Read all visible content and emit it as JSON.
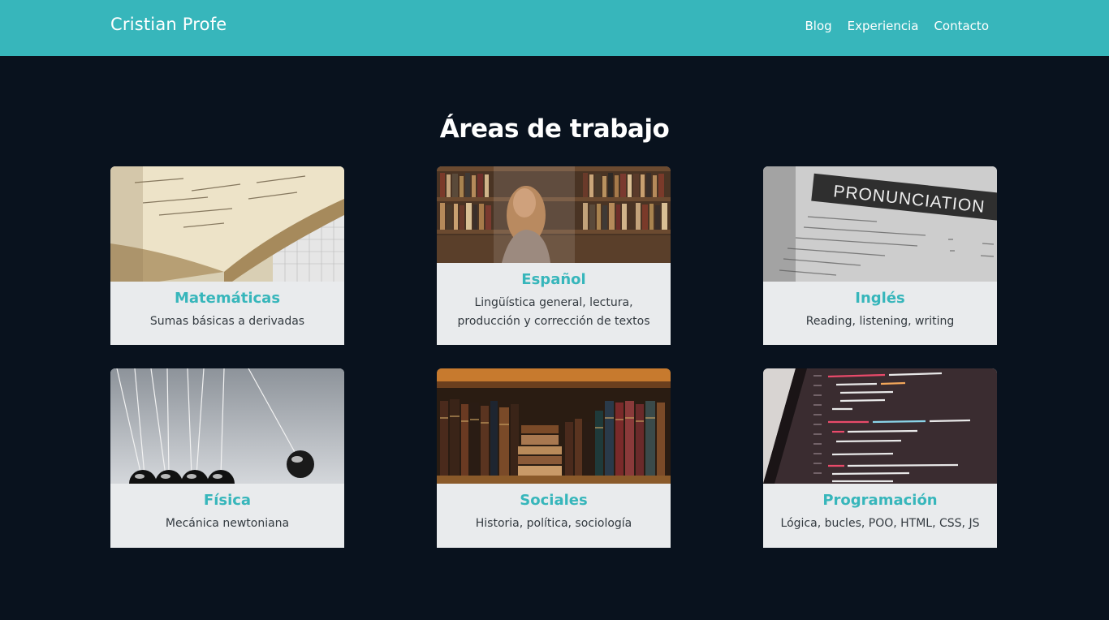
{
  "navbar": {
    "brand": "Cristian Profe",
    "links": [
      "Blog",
      "Experiencia",
      "Contacto"
    ]
  },
  "section": {
    "title": "Áreas de trabajo"
  },
  "cards": [
    {
      "title": "Matemáticas",
      "description": "Sumas básicas a derivadas",
      "image": "open-math-notebook"
    },
    {
      "title": "Español",
      "description": "Lingüística general, lectura, producción y corrección de textos",
      "image": "library-bookshelves"
    },
    {
      "title": "Inglés",
      "description": "Reading, listening, writing",
      "image": "pronunciation-dictionary",
      "image_text": "PRONUNCIATION"
    },
    {
      "title": "Física",
      "description": "Mecánica newtoniana",
      "image": "newtons-cradle"
    },
    {
      "title": "Sociales",
      "description": "Historia, política, sociología",
      "image": "old-books-shelf"
    },
    {
      "title": "Programación",
      "description": "Lógica, bucles, POO, HTML, CSS, JS",
      "image": "code-on-screen"
    }
  ],
  "colors": {
    "navbar": "#37b6bb",
    "background": "#09121e",
    "card_background": "#e9ebed",
    "accent": "#37b6bb"
  }
}
